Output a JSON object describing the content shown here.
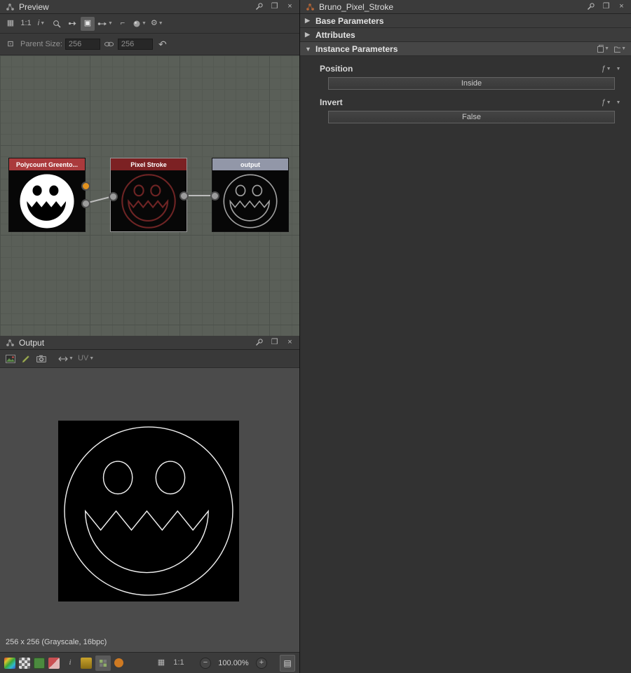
{
  "colors": {
    "accent_orange": "#e2921e",
    "wire": "#bcbcbc"
  },
  "preview": {
    "title": "Preview",
    "toolbar": {
      "zoom_label": "1:1",
      "info_label": "i"
    },
    "parent_size": {
      "label": "Parent Size:",
      "width": "256",
      "height": "256"
    }
  },
  "graph": {
    "nodes": [
      {
        "label": "Polycount Greento...",
        "header_color": "#aa3a3c"
      },
      {
        "label": "Pixel Stroke",
        "header_color": "#7c2123"
      },
      {
        "label": "output",
        "header_color": "#9297a8"
      }
    ]
  },
  "output": {
    "title": "Output",
    "toolbar": {
      "uv_label": "UV"
    },
    "info": "256 x 256 (Grayscale, 16bpc)",
    "statusbar": {
      "scale_label": "1:1",
      "zoom_value": "100.00%"
    }
  },
  "properties": {
    "title": "Bruno_Pixel_Stroke",
    "sections": [
      {
        "label": "Base Parameters"
      },
      {
        "label": "Attributes"
      },
      {
        "label": "Instance Parameters"
      }
    ],
    "params": [
      {
        "label": "Position",
        "value": "Inside"
      },
      {
        "label": "Invert",
        "value": "False"
      }
    ]
  }
}
